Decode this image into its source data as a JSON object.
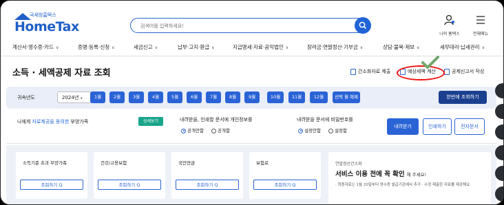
{
  "header": {
    "logo_sub": "국세청홈택스",
    "logo_main": "HomeTax",
    "search_placeholder": "검색어를 입력하세요!",
    "my_hometax": "나의 홈택스",
    "all_menu": "전체메뉴"
  },
  "menu": [
    "계산서·영수증·카드",
    "증명·등록·신청",
    "세금신고",
    "납부·고지·환급",
    "지급명세·자료·공익법인",
    "장려금·연말정산·기부금",
    "상담·불복·제보",
    "세무대리·납세관리"
  ],
  "page": {
    "title": "소득 · 세액공제 자료 조회",
    "actions": {
      "simple_data": "간소화자료 제출",
      "estimate_tax": "예상세액 계산",
      "deduction_form": "공제신고서 작성"
    }
  },
  "year_bar": {
    "label": "귀속년도",
    "year": "2024년",
    "months": [
      "1월",
      "2월",
      "3월",
      "4월",
      "5월",
      "6월",
      "7월",
      "8월",
      "9월",
      "10월",
      "11월",
      "12월"
    ],
    "select_all": "선택 월 해제",
    "lookup_all": "한번에 조회하기"
  },
  "info": {
    "dependents_pre": "나에게 ",
    "dependents_hl": "자료제공을 동의한",
    "dependents_post": " 부양가족",
    "detail_btn": "상세보기",
    "privacy_q": "내려받을, 인쇄할 문서에 개인정보를",
    "privacy_opt1": "공개안함",
    "privacy_opt2": "공개함",
    "password_q": "내려받을 문서에 비밀번호를",
    "password_opt1": "설정안함",
    "password_opt2": "설정함",
    "download": "내려받기",
    "print": "인쇄하기",
    "e_doc": "전자문서"
  },
  "cards": [
    {
      "title": "소득기준 초과 부양가족",
      "button": "조회하기 Q"
    },
    {
      "title": "건강/고용보험",
      "button": "조회하기 Q"
    },
    {
      "title": "국민연금",
      "button": "조회하기 Q"
    },
    {
      "title": "보험료",
      "button": "조회하기 Q"
    }
  ],
  "notice": {
    "small": "연말정산간소화",
    "big_bold": "서비스 이용 전에 꼭 확인",
    "big_tail": "해 주세요!",
    "desc": "· 최종자료는 1월 20일부터 영수증 발급기관에서 추가 · 수정 제출한 자료를 제공해요."
  },
  "colors": {
    "brand": "#1f5fc7",
    "accent": "#2a63d6",
    "highlight_circle": "#e11111",
    "check": "#6fa86a"
  }
}
